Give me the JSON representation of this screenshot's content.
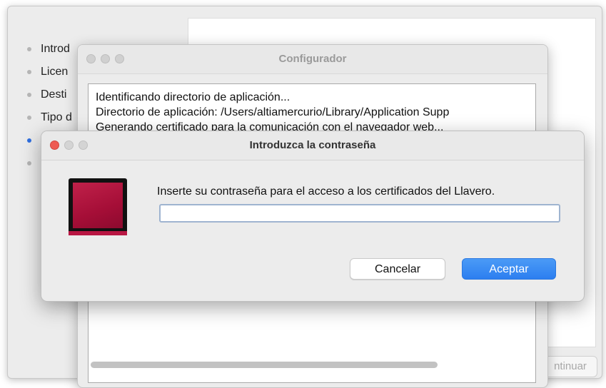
{
  "installer": {
    "sidebar_items": [
      {
        "label": "Introd"
      },
      {
        "label": "Licen"
      },
      {
        "label": "Desti"
      },
      {
        "label": "Tipo d"
      },
      {
        "label": ""
      },
      {
        "label": ""
      }
    ],
    "continue_label": "ntinuar"
  },
  "configurador": {
    "title": "Configurador",
    "log_lines": [
      "Identificando directorio de aplicación...",
      "Directorio de aplicación: /Users/altiamercurio/Library/Application Supp",
      "Generando certificado para la comunicación con el navegador web..."
    ]
  },
  "dialog": {
    "title": "Introduzca la contraseña",
    "prompt": "Inserte su contraseña para el acceso a los certificados del Llavero.",
    "password_value": "",
    "cancel_label": "Cancelar",
    "accept_label": "Aceptar"
  },
  "colors": {
    "accent": "#2c7ef0",
    "close_button": "#ee5a52",
    "app_icon": "#a50e37"
  }
}
